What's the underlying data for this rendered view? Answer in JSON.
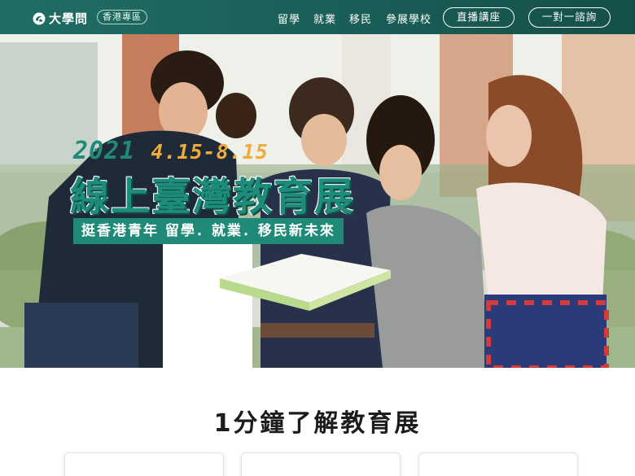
{
  "header": {
    "logo_text": "大學問",
    "region_badge": "香港專區",
    "nav": [
      "留學",
      "就業",
      "移民",
      "參展學校"
    ],
    "live_button": "直播講座",
    "consult_button": "一對一諮詢",
    "background_color": "#1d6b61"
  },
  "hero": {
    "year": "2021",
    "date_range": "4.15-8.15",
    "title": "線上臺灣教育展",
    "subtitle": "挺香港青年 留學．就業．移民新未來",
    "accent_color": "#1f8a78",
    "date_color": "#f0ac3a"
  },
  "section": {
    "title": "1分鐘了解教育展"
  }
}
